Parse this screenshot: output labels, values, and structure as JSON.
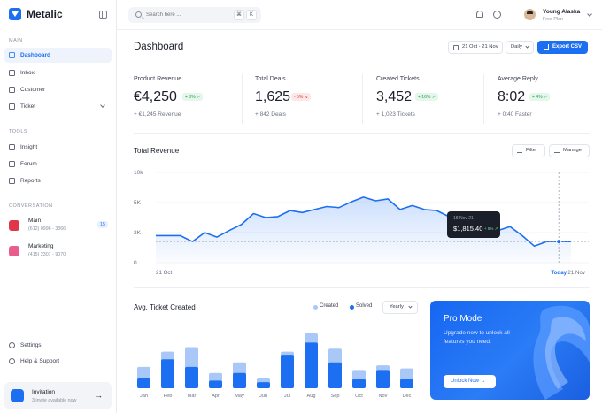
{
  "app": {
    "name": "Metalic"
  },
  "sidebar": {
    "sections": {
      "main": "MAIN",
      "tools": "TOOLS",
      "conversation": "CONVERSATION"
    },
    "main_items": [
      {
        "label": "Dashboard",
        "icon": "dashboard-icon",
        "active": true
      },
      {
        "label": "Inbox",
        "icon": "inbox-icon"
      },
      {
        "label": "Customer",
        "icon": "customer-icon"
      },
      {
        "label": "Ticket",
        "icon": "ticket-icon"
      }
    ],
    "tools_items": [
      {
        "label": "Insight",
        "icon": "insight-icon"
      },
      {
        "label": "Forum",
        "icon": "forum-icon"
      },
      {
        "label": "Reports",
        "icon": "reports-icon"
      }
    ],
    "conversations": [
      {
        "name": "Main",
        "phone": "(612) 0996 - 3366",
        "badge": "15",
        "color": "#e0364a"
      },
      {
        "name": "Marketing",
        "phone": "(415) 2307 - 9070",
        "color": "#e85d8e"
      }
    ],
    "bottom_items": [
      {
        "label": "Settings",
        "icon": "settings-icon"
      },
      {
        "label": "Help & Support",
        "icon": "help-icon"
      }
    ],
    "invitation": {
      "title": "Invitation",
      "subtitle": "3 invite available now"
    }
  },
  "topbar": {
    "search_placeholder": "Search here ...",
    "shortcut": [
      "⌘",
      "K"
    ],
    "user": {
      "name": "Young Alaska",
      "plan": "Free Plan"
    }
  },
  "dashboard": {
    "title": "Dashboard",
    "date_range": "21 Oct - 21 Nov",
    "period": "Daily",
    "export_label": "Export CSV"
  },
  "stats": [
    {
      "label": "Product Revenue",
      "value": "€4,250",
      "change": "+ 8% ↗",
      "trend": "up",
      "sub": "+ €1,245 Revenue"
    },
    {
      "label": "Total Deals",
      "value": "1,625",
      "change": "- 5% ↘",
      "trend": "down",
      "sub": "+ 842 Deals"
    },
    {
      "label": "Created Tickets",
      "value": "3,452",
      "change": "+ 16% ↗",
      "trend": "up",
      "sub": "+ 1,023 Tickets"
    },
    {
      "label": "Average Reply",
      "value": "8:02",
      "change": "+ 4% ↗",
      "trend": "up",
      "sub": "+ 0:40 Faster"
    }
  ],
  "revenue": {
    "title": "Total Revenue",
    "filter_label": "Filter",
    "manage_label": "Manage",
    "tooltip": {
      "date": "18 Nov 21",
      "value": "$1,815.40",
      "change": "+ 8% ↗"
    }
  },
  "tickets": {
    "title": "Avg. Ticket Created",
    "legend": {
      "created": "Created",
      "solved": "Solved"
    },
    "period": "Yearly"
  },
  "pro": {
    "title": "Pro Mode",
    "description": "Upgrade now to unlock all features you need.",
    "button": "Unlock Now →"
  },
  "colors": {
    "accent": "#1d6ff2",
    "accent_light": "#a9c8f8"
  },
  "chart_data": [
    {
      "type": "area",
      "title": "Total Revenue",
      "x_ticks": [
        "21 Oct",
        "Today",
        "21 Nov"
      ],
      "y_ticks": [
        "0",
        "2K",
        "5K",
        "10k"
      ],
      "ylim": [
        0,
        10000
      ],
      "series": [
        {
          "values": [
            1800,
            1800,
            1800,
            1400,
            2000,
            1700,
            2200,
            2800,
            3900,
            3500,
            3600,
            4200,
            4000,
            4300,
            4600,
            4500,
            5100,
            5900,
            5300,
            5600,
            4300,
            4700,
            4300,
            4200,
            3600,
            2800,
            2500,
            2800,
            2200,
            2600,
            1800,
            1100,
            1400,
            1400,
            1400
          ]
        }
      ],
      "highlight_index": 33
    },
    {
      "type": "bar",
      "title": "Avg. Ticket Created",
      "categories": [
        "Jan",
        "Feb",
        "Mar",
        "Apr",
        "May",
        "Jun",
        "Jul",
        "Aug",
        "Sep",
        "Oct",
        "Nov",
        "Dec"
      ],
      "series": [
        {
          "name": "Created",
          "values": [
            28,
            48,
            54,
            20,
            34,
            14,
            48,
            72,
            52,
            24,
            30,
            26
          ]
        },
        {
          "name": "Solved",
          "values": [
            14,
            38,
            28,
            10,
            20,
            8,
            44,
            60,
            34,
            12,
            24,
            12
          ]
        }
      ]
    }
  ]
}
